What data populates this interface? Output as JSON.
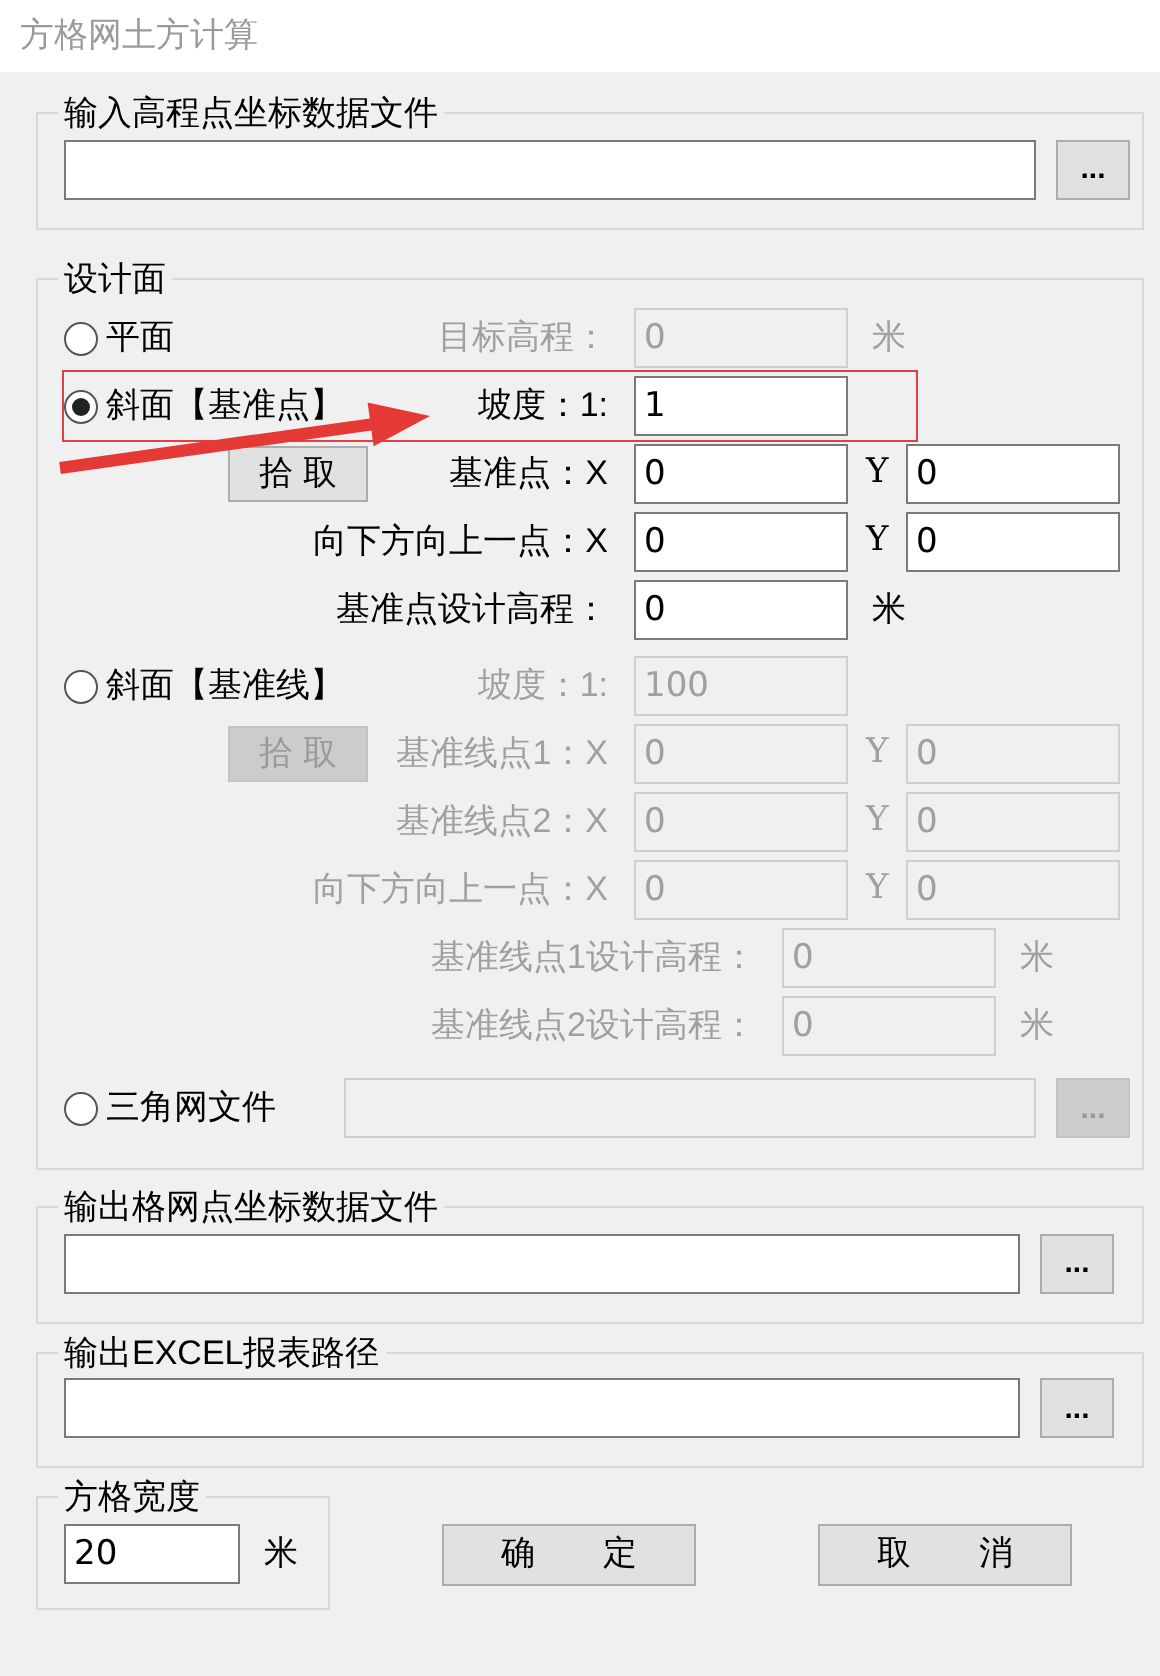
{
  "window": {
    "title": "方格网土方计算"
  },
  "input_file": {
    "legend": "输入高程点坐标数据文件",
    "browse_button": "..."
  },
  "design_surface": {
    "legend": "设计面",
    "options": [
      {
        "kind": "fields",
        "label": "平面",
        "selected": false,
        "inline": {
          "label": "目标高程：",
          "value": "0",
          "unit": "米"
        }
      },
      {
        "kind": "fields",
        "label": "斜面【基准点】",
        "selected": true,
        "inline": {
          "label": "坡度：1:",
          "value": "1"
        },
        "pick_button": "拾 取",
        "rows": [
          {
            "kind": "xy",
            "label": "基准点：X",
            "value": "0",
            "y_label": "Y",
            "y_value": "0"
          },
          {
            "kind": "xy",
            "label": "向下方向上一点：X",
            "value": "0",
            "y_label": "Y",
            "y_value": "0"
          },
          {
            "kind": "unit",
            "label": "基准点设计高程：",
            "value": "0",
            "unit": "米"
          }
        ]
      },
      {
        "kind": "fields",
        "label": "斜面【基准线】",
        "selected": false,
        "inline": {
          "label": "坡度：1:",
          "value": "100"
        },
        "pick_button": "拾 取",
        "rows": [
          {
            "kind": "xy",
            "label": "基准线点1：X",
            "value": "0",
            "y_label": "Y",
            "y_value": "0"
          },
          {
            "kind": "xy",
            "label": "基准线点2：X",
            "value": "0",
            "y_label": "Y",
            "y_value": "0"
          },
          {
            "kind": "xy",
            "label": "向下方向上一点：X",
            "value": "0",
            "y_label": "Y",
            "y_value": "0"
          },
          {
            "kind": "long",
            "label": "基准线点1设计高程：",
            "value": "0",
            "unit": "米"
          },
          {
            "kind": "long",
            "label": "基准线点2设计高程：",
            "value": "0",
            "unit": "米"
          }
        ]
      },
      {
        "kind": "file",
        "label": "三角网文件",
        "selected": false,
        "browse_button": "..."
      }
    ]
  },
  "output_grid_file": {
    "legend": "输出格网点坐标数据文件",
    "browse_button": "..."
  },
  "output_excel": {
    "legend": "输出EXCEL报表路径",
    "browse_button": "..."
  },
  "grid_width": {
    "legend": "方格宽度",
    "value": "20",
    "unit": "米"
  },
  "buttons": [
    "确　　定",
    "取　　消"
  ]
}
